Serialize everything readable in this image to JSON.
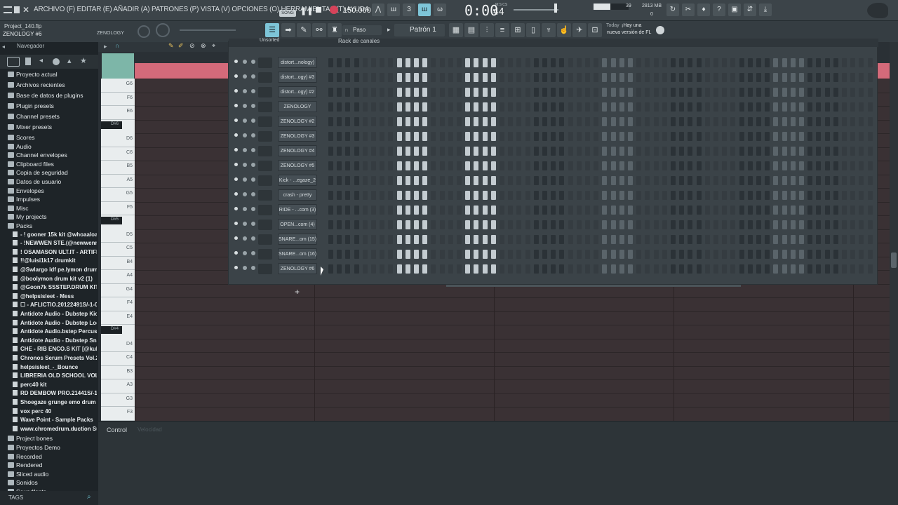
{
  "menu": {
    "text": "ARCHIVO (F) EDITAR (E) AÑADIR (A) PATRONES (P) VISTA (V) OPCIONES (O) HERRAMIENTAS (T) AYUDA"
  },
  "transport": {
    "mode": "SONG",
    "tempo": "150.000",
    "time": "0:00",
    "time_small": "44",
    "time_unit": "M:S:CS",
    "cpu": "39",
    "memory": "2813 MB",
    "voices": "0"
  },
  "project": {
    "file": "Project_140.flp",
    "selected": "ZENOLOGY #6",
    "hint": "ZENOLOGY"
  },
  "toolbar": {
    "snap": "Paso",
    "pattern": "Patrón 1"
  },
  "news": {
    "when": "Today",
    "text1": "¡Hay una",
    "text2": "nueva versión de FL"
  },
  "browser": {
    "title": "Navegador",
    "items": [
      "Proyecto actual",
      "Archivos recientes",
      "Base de datos de plugins",
      "Plugin presets",
      "Channel presets",
      "Mixer presets",
      "Scores",
      "Audio",
      "Channel envelopes",
      "Clipboard files",
      "Copia de seguridad",
      "Datos de usuario",
      "Envelopes",
      "Impulses",
      "Misc",
      "My projects",
      "Packs"
    ],
    "packs": [
      "- ! gooner 15k kit @whoaaloa",
      "- !NEWWEN STE.(@newwenmus)",
      "!  OSAMASON ULT.IT - ARTIFICIAL",
      "!!@luisi1k17 drumkit",
      "@Swlargo ldf pe.lymon drum kit",
      "@boolymon drum kit v2 (1)",
      "@Goon7k SSSTEP.DRUM KIT 2k26",
      "@helpsisleet - Mess",
      "☐ - AFLICTIO.20122491S/-1-001",
      "Antidote Audio - Dubstep Kicks",
      "Antidote Audio - Dubstep Loops",
      "Antidote Audio.bstep Percussion",
      "Antidote Audio - Dubstep Snares",
      "CHE - RIB ENCO.S KIT [@kubfu1]",
      "Chronos Serum Presets Vol.2",
      "helpsisleet_-_Bounce",
      "LIBRERIA OLD SCHOOL  VOL 2",
      "perc40 kit",
      "RD DEMBOW PRO.21441S/-1-001",
      "Shoegaze grunge emo drum kit",
      "vox perc 40",
      "Wave Point - Sample Packs",
      "www.chromedrum.duction Suite"
    ],
    "bottom": [
      "Project bones",
      "Proyectos Demo",
      "Recorded",
      "Rendered",
      "Sliced audio",
      "Sonidos",
      "Soundfonts"
    ],
    "tags": "TAGS"
  },
  "piano": {
    "labels": [
      "G6",
      "F6",
      "E6",
      "D#6",
      "D6",
      "C6",
      "B5",
      "A5",
      "G5",
      "F5",
      "D#5",
      "D5",
      "C5",
      "B4",
      "A4",
      "G4",
      "F4",
      "E4",
      "D#4",
      "D4",
      "C4",
      "B3",
      "A3",
      "G3",
      "F3"
    ]
  },
  "rack": {
    "header": "Unsorted",
    "title": "Rack de canales",
    "channels": [
      "distort...nology)",
      "distort...ogy) #3",
      "distort...ogy) #2",
      "ZENOLOGY",
      "ZENOLOGY #2",
      "ZENOLOGY #3",
      "ZENOLOGY #4",
      "ZENOLOGY #5",
      "Kick - ...egaze_2",
      "crash - pretty",
      "RIDE - ...com (3)",
      "OPEN...com (4)",
      "SNARE...om (15)",
      "SNARE...om (16)",
      "ZENOLOGY #6"
    ],
    "add": "+",
    "colors": {
      "step_off": "#2b3237",
      "step_on": "#c4ccd1",
      "step_dim": "#5a646a"
    }
  },
  "control": {
    "label": "Control",
    "sub": "Velocidad"
  }
}
